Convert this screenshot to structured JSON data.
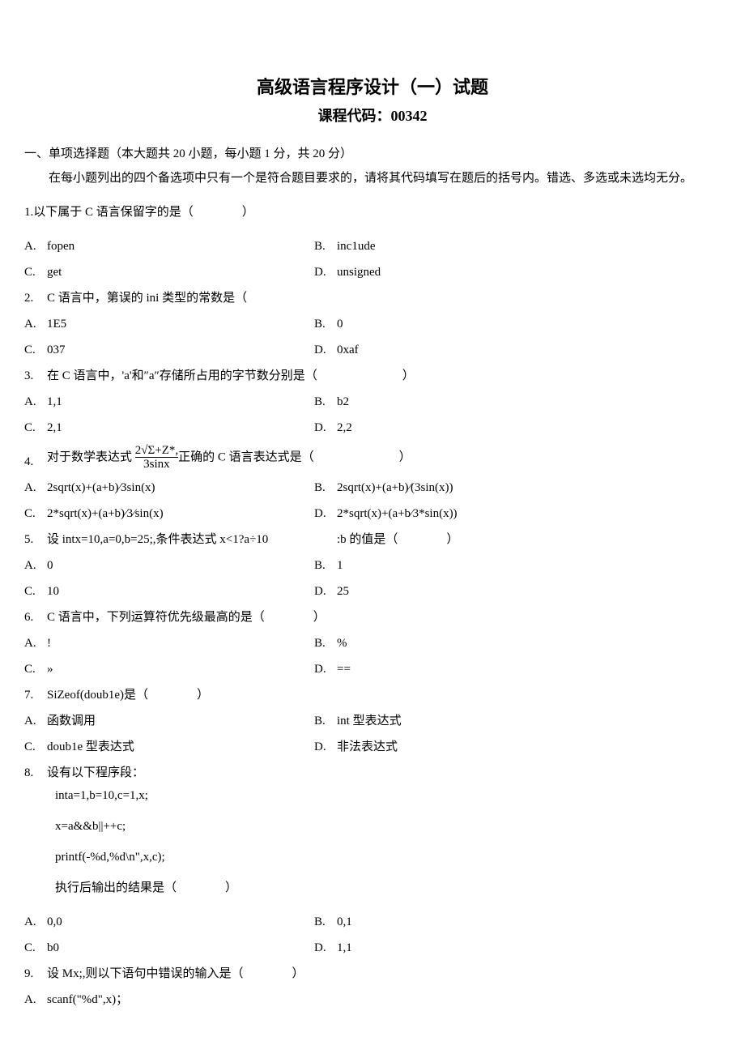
{
  "title": "高级语言程序设计（一）试题",
  "subtitle_label": "课程代码：",
  "subtitle_code": "00342",
  "section1_header": "一、单项选择题（本大题共 20 小题，每小题 1 分，共 20 分）",
  "section1_instruction": "在每小题列出的四个备选项中只有一个是符合题目要求的，请将其代码填写在题后的括号内。错选、多选或未选均无分。",
  "q1": {
    "num": "1.",
    "text": "以下属于 C 语言保留字的是（　　　　）",
    "A": "fopen",
    "B": "inc1ude",
    "C": "get",
    "D": "unsigned"
  },
  "q2": {
    "num": "2.",
    "text": "C 语言中，第误的 ini 类型的常数是（",
    "A": "1E5",
    "B": "0",
    "C": "037",
    "D": "0xaf"
  },
  "q3": {
    "num": "3.",
    "text": "在 C 语言中，'a'和″a″存储所占用的字节数分别是（　　　　　　　）",
    "A": "1,1",
    "B": "b2",
    "C": "2,1",
    "D": "2,2"
  },
  "q4": {
    "num": "4.",
    "text_pre": "对于数学表达式 ",
    "numer": "2√Σ+Z*,",
    "denom": "3sinx",
    "text_post": "正确的 C 语言表达式是（　　　　　　　）",
    "A": "2sqrt(x)+(a+b)⁄3sin(x)",
    "B": "2sqrt(x)+(a+b)⁄(3sin(x))",
    "C": "2*sqrt(x)+(a+b)⁄3⁄sin(x)",
    "D": "2*sqrt(x)+(a+b⁄3*sin(x))"
  },
  "q5": {
    "num": "5.",
    "text_l": "设 intx=10,a=0,b=25;,条件表达式 x<1?a÷10",
    "text_r": ":b 的值是（　　　　）",
    "A": "0",
    "B": "1",
    "C": "10",
    "D": "25"
  },
  "q6": {
    "num": "6.",
    "text": "C 语言中，下列运算符优先级最高的是（　　　　）",
    "A": "!",
    "B": "%",
    "C": "»",
    "D": "=="
  },
  "q7": {
    "num": "7.",
    "text": "SiZeof(doub1e)是（　　　　）",
    "A": "函数调用",
    "B": "int 型表达式",
    "C": "doub1e 型表达式",
    "D": "非法表达式"
  },
  "q8": {
    "num": "8.",
    "text": "设有以下程序段：",
    "line1": "inta=1,b=10,c=1,x;",
    "line2": "x=a&&b||++c;",
    "line3": "printf(-%d,%d\\n\",x,c);",
    "line4": "执行后输出的结果是（　　　　）",
    "A": "0,0",
    "B": "0,1",
    "C": "b0",
    "D": "1,1"
  },
  "q9": {
    "num": "9.",
    "text": "设 Mx;,则以下语句中错误的输入是（　　　　）",
    "A_label": "A.",
    "A_text": " scanf(\"%d\",x)；"
  }
}
